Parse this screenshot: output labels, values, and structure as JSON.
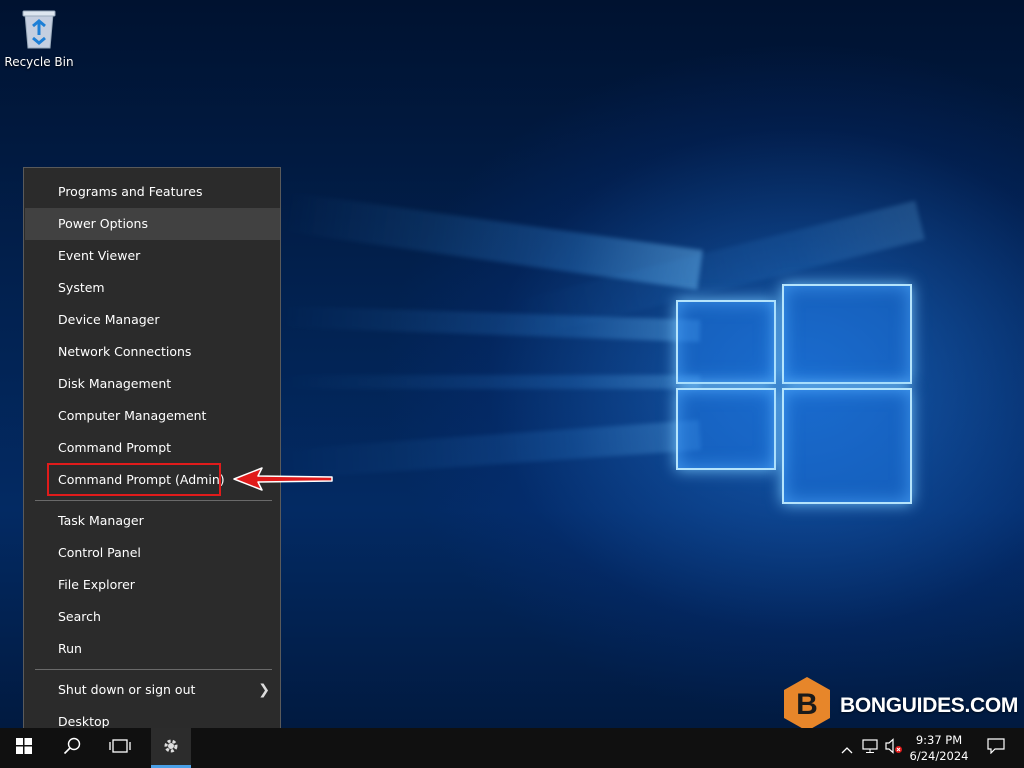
{
  "desktop": {
    "icons": [
      {
        "label": "Recycle Bin",
        "icon": "recycle-bin-icon"
      }
    ]
  },
  "winx_menu": {
    "group1": [
      {
        "label": "Programs and Features"
      },
      {
        "label": "Power Options",
        "state": "hovered"
      },
      {
        "label": "Event Viewer"
      },
      {
        "label": "System"
      },
      {
        "label": "Device Manager"
      },
      {
        "label": "Network Connections"
      },
      {
        "label": "Disk Management"
      },
      {
        "label": "Computer Management"
      },
      {
        "label": "Command Prompt"
      },
      {
        "label": "Command Prompt (Admin)",
        "state": "highlighted"
      }
    ],
    "group2": [
      {
        "label": "Task Manager"
      },
      {
        "label": "Control Panel"
      },
      {
        "label": "File Explorer"
      },
      {
        "label": "Search"
      },
      {
        "label": "Run"
      }
    ],
    "group3": [
      {
        "label": "Shut down or sign out",
        "has_submenu": true
      },
      {
        "label": "Desktop"
      }
    ],
    "highlight_color": "#e01b1b"
  },
  "watermark": {
    "text": "BONGUIDES.COM",
    "icon": "bonguides-logo-icon",
    "color": "#e7862a"
  },
  "taskbar": {
    "buttons": [
      {
        "name": "start",
        "icon": "windows-logo-icon"
      },
      {
        "name": "search",
        "icon": "search-icon"
      },
      {
        "name": "task-view",
        "icon": "task-view-icon"
      },
      {
        "name": "server-manager",
        "icon": "gear-icon",
        "active": true
      }
    ],
    "tray_icons": [
      "chevron-up-icon",
      "network-icon",
      "volume-muted-icon"
    ],
    "clock": {
      "time": "9:37 PM",
      "date": "6/24/2024"
    },
    "notification_icon": "action-center-icon",
    "accent": "#4a9fe6"
  }
}
